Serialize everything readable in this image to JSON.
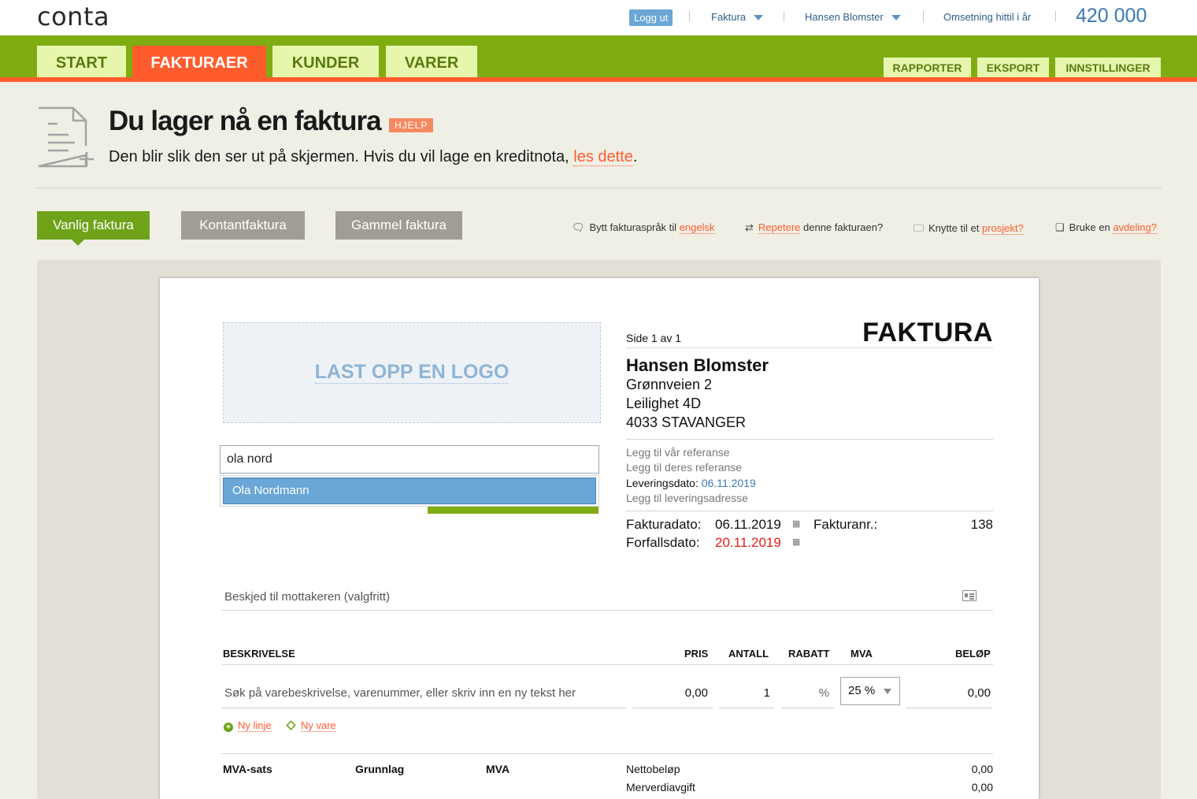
{
  "app": {
    "logo_text": "conta",
    "logout_label": "Logg ut",
    "menu_invoice": "Faktura",
    "menu_company": "Hansen Blomster",
    "revenue_label": "Omsetning hittil i år",
    "revenue_value": "420 000"
  },
  "nav": {
    "tabs": [
      {
        "label": "START"
      },
      {
        "label": "FAKTURAER"
      },
      {
        "label": "KUNDER"
      },
      {
        "label": "VARER"
      }
    ],
    "right": [
      {
        "label": "RAPPORTER"
      },
      {
        "label": "EKSPORT"
      },
      {
        "label": "INNSTILLINGER"
      }
    ]
  },
  "header": {
    "title": "Du lager nå en faktura",
    "help": "HJELP",
    "subtitle_text": "Den blir slik den ser ut på skjermen. Hvis du vil lage en kreditnota,",
    "subtitle_link": "les dette",
    "subtitle_end": "."
  },
  "invoice_types": [
    {
      "label": "Vanlig faktura"
    },
    {
      "label": "Kontantfaktura"
    },
    {
      "label": "Gammel faktura"
    }
  ],
  "options": {
    "language_text": "Bytt fakturaspråk til",
    "language_link": "engelsk",
    "repeat_link": "Repetere",
    "repeat_text": "denne fakturaen?",
    "project_text": "Knytte til et",
    "project_link": "prosjekt?",
    "dept_text": "Bruke en",
    "dept_link": "avdeling?"
  },
  "invoice": {
    "logo_upload": "LAST OPP EN LOGO",
    "customer_search_value": "ola nord",
    "suggestion": "Ola Nordmann",
    "page_label": "Side 1 av 1",
    "doc_title": "FAKTURA",
    "recipient": {
      "name": "Hansen Blomster",
      "line1": "Grønnveien 2",
      "line2": "Leilighet 4D",
      "line3": "4033 STAVANGER"
    },
    "our_ref": "Legg til vår referanse",
    "their_ref": "Legg til deres referanse",
    "delivery_date_label": "Leveringsdato:",
    "delivery_date": "06.11.2019",
    "delivery_address": "Legg til leveringsadresse",
    "invoice_date_label": "Fakturadato:",
    "invoice_date": "06.11.2019",
    "due_date_label": "Forfallsdato:",
    "due_date": "20.11.2019",
    "invoice_no_label": "Fakturanr.:",
    "invoice_no": "138",
    "message_placeholder": "Beskjed til mottakeren (valgfritt)",
    "columns": {
      "description": "BESKRIVELSE",
      "price": "PRIS",
      "qty": "ANTALL",
      "discount": "RABATT",
      "vat": "MVA",
      "amount": "BELØP"
    },
    "line": {
      "description_placeholder": "Søk på varebeskrivelse, varenummer, eller skriv inn en ny tekst her",
      "price": "0,00",
      "qty": "1",
      "discount_unit": "%",
      "vat": "25 %",
      "amount": "0,00"
    },
    "add_line": "Ny linje",
    "add_item": "Ny vare",
    "summary": {
      "vat_rate": "MVA-sats",
      "base": "Grunnlag",
      "vat": "MVA",
      "net_label": "Nettobeløp",
      "net_value": "0,00",
      "vat_label": "Merverdiavgift",
      "vat_value": "0,00"
    }
  },
  "colors": {
    "nav_green": "#80ac13",
    "accent_orange": "#ff5c2e",
    "link_blue": "#3a79b5"
  }
}
